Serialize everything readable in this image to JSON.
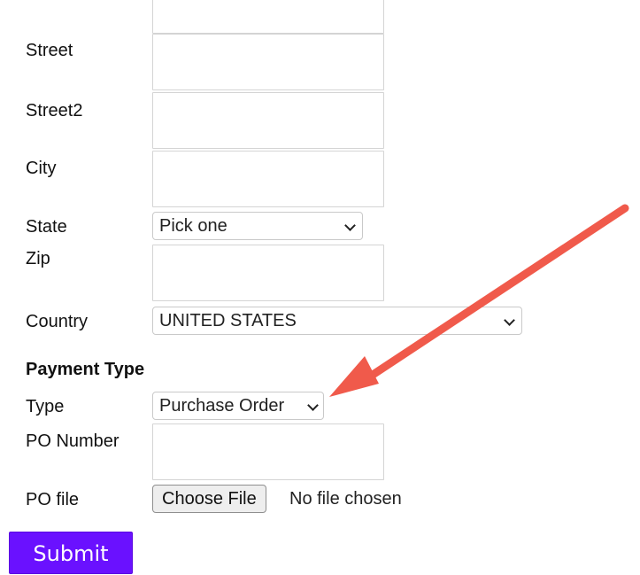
{
  "form": {
    "fields": {
      "street_label": "Street",
      "street2_label": "Street2",
      "city_label": "City",
      "state_label": "State",
      "state_value": "Pick one",
      "zip_label": "Zip",
      "country_label": "Country",
      "country_value": "UNITED STATES"
    },
    "payment": {
      "section_title": "Payment Type",
      "type_label": "Type",
      "type_value": "Purchase Order",
      "po_number_label": "PO Number",
      "po_file_label": "PO file",
      "choose_file_label": "Choose File",
      "file_status": "No file chosen"
    },
    "submit_label": "Submit"
  },
  "colors": {
    "submit_background": "#6a11ff",
    "annotation_arrow": "#f05a4b"
  },
  "icons": {
    "select_chevron": "chevron-down-icon",
    "annotation": "arrow-annotation-icon"
  }
}
